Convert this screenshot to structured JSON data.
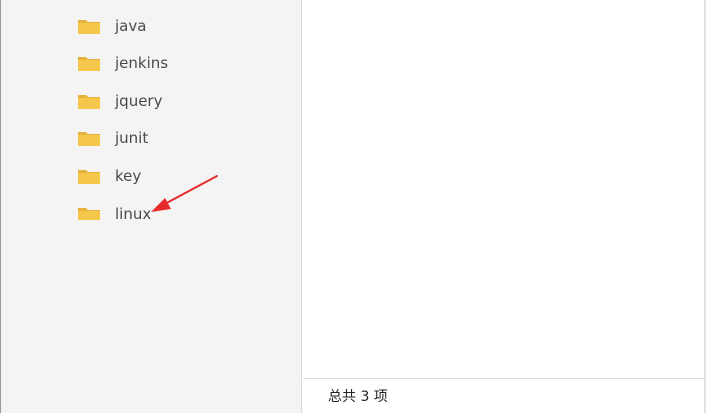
{
  "folders": [
    {
      "label": "java",
      "icon": "folder-icon"
    },
    {
      "label": "jenkins",
      "icon": "folder-icon"
    },
    {
      "label": "jquery",
      "icon": "folder-icon"
    },
    {
      "label": "junit",
      "icon": "folder-icon"
    },
    {
      "label": "key",
      "icon": "folder-icon"
    },
    {
      "label": "linux",
      "icon": "folder-icon"
    }
  ],
  "status_bar": {
    "item_count_text": "总共 3 项"
  },
  "colors": {
    "folder": "#f5c84b",
    "folder_dark": "#e6b23a",
    "arrow": "#e52b2b"
  }
}
